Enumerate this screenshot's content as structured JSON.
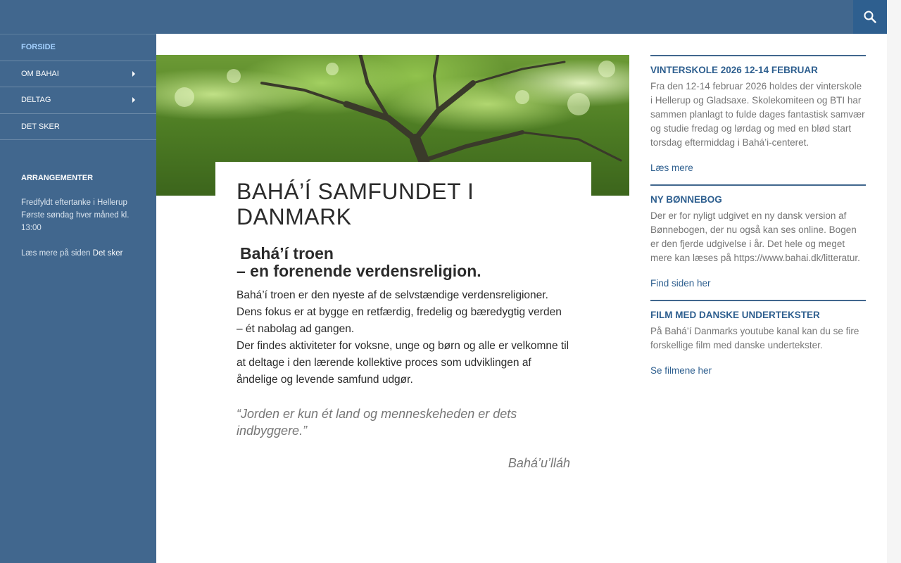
{
  "header": {
    "search_icon": "search-icon"
  },
  "nav": {
    "items": [
      {
        "label": "FORSIDE",
        "active": true,
        "has_submenu": false
      },
      {
        "label": "OM BAHAI",
        "active": false,
        "has_submenu": true
      },
      {
        "label": "DELTAG",
        "active": false,
        "has_submenu": true
      },
      {
        "label": "DET SKER",
        "active": false,
        "has_submenu": false
      }
    ]
  },
  "left_widget": {
    "title": "ARRANGEMENTER",
    "event_line1": "Fredfyldt eftertanke i Hellerup",
    "event_line2": "Første søndag hver måned kl. 13:00",
    "more_prefix": "Læs mere på siden ",
    "more_link": "Det sker"
  },
  "main": {
    "title": "BAHÁ’Í SAMFUNDET I DANMARK",
    "subtitle_line1": "Bahá’í troen",
    "subtitle_line2": "– en forenende verdensreligion.",
    "paragraph1": "Bahá’í troen er den nyeste af de selvstændige verdensreligioner. Dens fokus er at bygge en retfærdig, fredelig og bæredygtig verden – ét nabolag ad gangen.",
    "paragraph2": "Der findes aktiviteter for voksne, unge og børn og alle er velkomne til at deltage i den lærende kollektive proces som udviklingen af åndelige og levende samfund udgør.",
    "quote": "“Jorden er kun ét land og menneskeheden er dets indbyggere.”",
    "attribution": "Bahá’u’lláh"
  },
  "right_widgets": [
    {
      "title": "VINTERSKOLE 2026 12-14 FEBRUAR",
      "text": "Fra den 12-14 februar 2026 holdes der vinterskole i Hellerup og Gladsaxe. Skolekomiteen og BTI har sammen planlagt to fulde dages fantastisk samvær og studie fredag og lørdag og med en blød start torsdag eftermiddag i Bahá’i-centeret.",
      "link": "Læs mere"
    },
    {
      "title": "NY BØNNEBOG",
      "text": "Der er for nyligt udgivet en ny dansk version af Bønnebogen, der nu også kan ses online. Bogen er den fjerde udgivelse i år. Det hele og meget mere kan læses på https://www.bahai.dk/litteratur.",
      "link": "Find siden her"
    },
    {
      "title": "FILM MED DANSKE UNDERTEKSTER",
      "text": "På Bahá’í Danmarks youtube kanal kan du se fire forskellige film med danske undertekster.",
      "link": "Se filmene her"
    }
  ],
  "colors": {
    "brand_blue": "#41678e",
    "link_blue": "#2e5f8f",
    "active_nav": "#a4d1ff"
  }
}
